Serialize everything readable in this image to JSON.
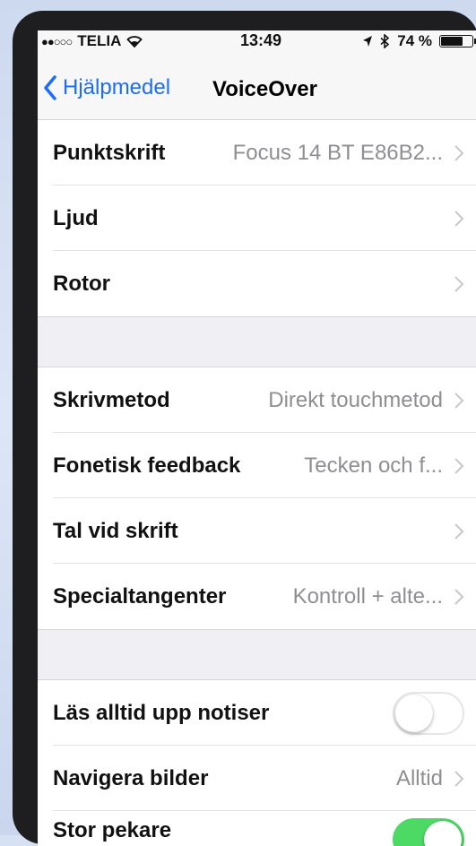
{
  "status_bar": {
    "signal_dots": "●●○○○",
    "carrier": "TELIA",
    "wifi_icon": "wifi-icon",
    "time": "13:49",
    "location_icon": "location-arrow-icon",
    "bluetooth_icon": "bluetooth-icon",
    "battery_percent": "74 %",
    "battery_level": 0.74
  },
  "nav": {
    "back_label": "Hjälpmedel",
    "title": "VoiceOver"
  },
  "sections": [
    {
      "rows": [
        {
          "label": "Punktskrift",
          "value": "Focus 14 BT E86B2...",
          "type": "disclosure"
        },
        {
          "label": "Ljud",
          "value": "",
          "type": "disclosure"
        },
        {
          "label": "Rotor",
          "value": "",
          "type": "disclosure"
        }
      ]
    },
    {
      "rows": [
        {
          "label": "Skrivmetod",
          "value": "Direkt touchmetod",
          "type": "disclosure"
        },
        {
          "label": "Fonetisk feedback",
          "value": "Tecken och f...",
          "type": "disclosure"
        },
        {
          "label": "Tal vid skrift",
          "value": "",
          "type": "disclosure"
        },
        {
          "label": "Specialtangenter",
          "value": "Kontroll + alte...",
          "type": "disclosure"
        }
      ]
    },
    {
      "rows": [
        {
          "label": "Läs alltid upp notiser",
          "type": "toggle",
          "on": false
        },
        {
          "label": "Navigera bilder",
          "value": "Alltid",
          "type": "disclosure"
        },
        {
          "label": "Stor pekare",
          "type": "toggle",
          "on": true
        }
      ]
    }
  ],
  "colors": {
    "accent": "#1d6bff",
    "toggle_on": "#4cd964",
    "secondary_text": "#8e8e93",
    "group_background": "#efeff4"
  }
}
